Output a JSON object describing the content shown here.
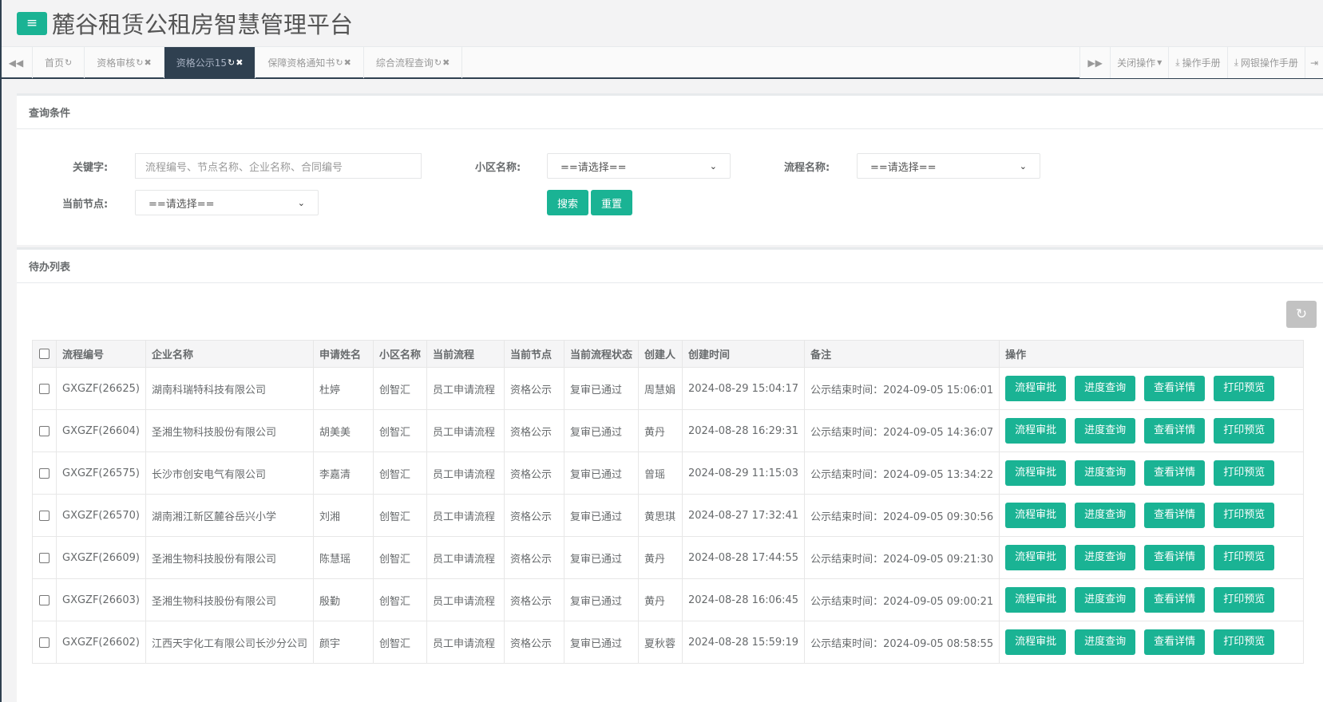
{
  "header": {
    "menu_icon": "menu-icon",
    "title": "麓谷租赁公租房智慧管理平台"
  },
  "tabs": {
    "items": [
      {
        "label": "首页",
        "active": false,
        "closable": false
      },
      {
        "label": "资格审核",
        "active": false,
        "closable": true
      },
      {
        "label": "资格公示15",
        "active": true,
        "closable": true
      },
      {
        "label": "保障资格通知书",
        "active": false,
        "closable": true
      },
      {
        "label": "综合流程查询",
        "active": false,
        "closable": true
      }
    ],
    "close_ops": "关闭操作",
    "manual": "操作手册",
    "bank_manual": "网银操作手册"
  },
  "query": {
    "title": "查询条件",
    "keyword_label": "关键字:",
    "keyword_placeholder": "流程编号、节点名称、企业名称、合同编号",
    "community_label": "小区名称:",
    "community_value": "==请选择==",
    "flow_label": "流程名称:",
    "flow_value": "==请选择==",
    "node_label": "当前节点:",
    "node_value": "==请选择==",
    "search_btn": "搜索",
    "reset_btn": "重置"
  },
  "list": {
    "title": "待办列表",
    "columns": [
      "流程编号",
      "企业名称",
      "申请姓名",
      "小区名称",
      "当前流程",
      "当前节点",
      "当前流程状态",
      "创建人",
      "创建时间",
      "备注",
      "操作"
    ],
    "actions": [
      "流程审批",
      "进度查询",
      "查看详情",
      "打印预览"
    ],
    "rows": [
      {
        "id": "GXGZF(26625)",
        "company": "湖南科瑞特科技有限公司",
        "applicant": "杜婷",
        "community": "创智汇",
        "flow": "员工申请流程",
        "node": "资格公示",
        "status": "复审已通过",
        "creator": "周慧娟",
        "created": "2024-08-29 15:04:17",
        "remark": "公示结束时间：2024-09-05 15:06:01"
      },
      {
        "id": "GXGZF(26604)",
        "company": "圣湘生物科技股份有限公司",
        "applicant": "胡美美",
        "community": "创智汇",
        "flow": "员工申请流程",
        "node": "资格公示",
        "status": "复审已通过",
        "creator": "黄丹",
        "created": "2024-08-28 16:29:31",
        "remark": "公示结束时间：2024-09-05 14:36:07"
      },
      {
        "id": "GXGZF(26575)",
        "company": "长沙市创安电气有限公司",
        "applicant": "李嘉清",
        "community": "创智汇",
        "flow": "员工申请流程",
        "node": "资格公示",
        "status": "复审已通过",
        "creator": "曾瑶",
        "created": "2024-08-29 11:15:03",
        "remark": "公示结束时间：2024-09-05 13:34:22"
      },
      {
        "id": "GXGZF(26570)",
        "company": "湖南湘江新区麓谷岳兴小学",
        "applicant": "刘湘",
        "community": "创智汇",
        "flow": "员工申请流程",
        "node": "资格公示",
        "status": "复审已通过",
        "creator": "黄思琪",
        "created": "2024-08-27 17:32:41",
        "remark": "公示结束时间：2024-09-05 09:30:56"
      },
      {
        "id": "GXGZF(26609)",
        "company": "圣湘生物科技股份有限公司",
        "applicant": "陈慧瑶",
        "community": "创智汇",
        "flow": "员工申请流程",
        "node": "资格公示",
        "status": "复审已通过",
        "creator": "黄丹",
        "created": "2024-08-28 17:44:55",
        "remark": "公示结束时间：2024-09-05 09:21:30"
      },
      {
        "id": "GXGZF(26603)",
        "company": "圣湘生物科技股份有限公司",
        "applicant": "殷勤",
        "community": "创智汇",
        "flow": "员工申请流程",
        "node": "资格公示",
        "status": "复审已通过",
        "creator": "黄丹",
        "created": "2024-08-28 16:06:45",
        "remark": "公示结束时间：2024-09-05 09:00:21"
      },
      {
        "id": "GXGZF(26602)",
        "company": "江西天宇化工有限公司长沙分公司",
        "applicant": "颜宇",
        "community": "创智汇",
        "flow": "员工申请流程",
        "node": "资格公示",
        "status": "复审已通过",
        "creator": "夏秋蓉",
        "created": "2024-08-28 15:59:19",
        "remark": "公示结束时间：2024-09-05 08:58:55"
      }
    ]
  },
  "colors": {
    "accent": "#1ab394",
    "dark": "#2f4050"
  }
}
